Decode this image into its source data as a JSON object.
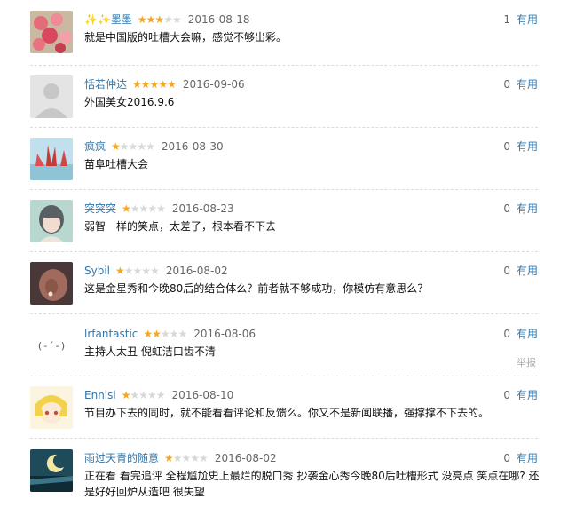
{
  "reviews": [
    {
      "user": "✨✨墨墨",
      "rating": 3,
      "date": "2016-08-18",
      "votes": "1",
      "useful": "有用",
      "comment": "就是中国版的吐槽大会嘛，感觉不够出彩。"
    },
    {
      "user": "恬若仲达",
      "rating": 5,
      "date": "2016-09-06",
      "votes": "0",
      "useful": "有用",
      "comment": "外国美女2016.9.6"
    },
    {
      "user": "疯疯",
      "rating": 1,
      "date": "2016-08-30",
      "votes": "0",
      "useful": "有用",
      "comment": "苗阜吐槽大会"
    },
    {
      "user": "突突突",
      "rating": 1,
      "date": "2016-08-23",
      "votes": "0",
      "useful": "有用",
      "comment": "弱智一样的笑点，太差了，根本看不下去"
    },
    {
      "user": "Sybil",
      "rating": 1,
      "date": "2016-08-02",
      "votes": "0",
      "useful": "有用",
      "comment": "这是金星秀和今晚80后的结合体么？前者就不够成功，你模仿有意思么？"
    },
    {
      "user": "lrfantastic",
      "rating": 2,
      "date": "2016-08-06",
      "votes": "0",
      "useful": "有用",
      "comment": "主持人太丑 倪虹洁口齿不清",
      "report": "举报",
      "avatar_text": "(-´-)"
    },
    {
      "user": "Ennisi",
      "rating": 1,
      "date": "2016-08-10",
      "votes": "0",
      "useful": "有用",
      "comment": "节目办下去的同时，就不能看看评论和反馈么。你又不是新闻联播，强撑撑不下去的。"
    },
    {
      "user": "雨过天青的随意",
      "rating": 1,
      "date": "2016-08-02",
      "votes": "0",
      "useful": "有用",
      "comment": "正在看 看完追评 全程尴尬史上最烂的脱口秀 抄袭金心秀今晚80后吐槽形式 没亮点 笑点在哪? 还是好好回炉从造吧 很失望"
    }
  ],
  "colors": {
    "accent": "#3377aa",
    "star": "#f5a623",
    "star_off": "#d8d8d8"
  }
}
